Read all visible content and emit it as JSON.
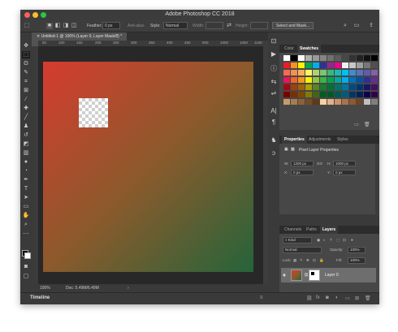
{
  "window": {
    "title": "Adobe Photoshop CC 2018"
  },
  "options_bar": {
    "feather_label": "Feather:",
    "feather_value": "0 px",
    "antialias_label": "Anti-alias",
    "style_label": "Style:",
    "style_value": "Normal",
    "width_label": "Width:",
    "height_label": "Height:",
    "select_mask_label": "Select and Mask..."
  },
  "document": {
    "tab_label": "Untitled-1 @ 100% (Layer 0, Layer Mask/8) *",
    "zoom": "100%",
    "doc_info": "Doc: 5.49M/6.49M"
  },
  "ruler": {
    "ticks": [
      "50",
      "100",
      "150",
      "200",
      "250",
      "300",
      "350",
      "400",
      "450",
      "500",
      "550",
      "600",
      "650",
      "700",
      "750",
      "800",
      "850",
      "900",
      "950",
      "1000",
      "1050",
      "1100"
    ]
  },
  "timeline": {
    "label": "Timeline"
  },
  "swatches_panel": {
    "tabs": [
      "Color",
      "Swatches"
    ],
    "active_tab": "Swatches",
    "colors": [
      [
        "#ffffff",
        "#000000",
        "#ffffff",
        "#b0b0b0",
        "#9a9a9a",
        "#858585",
        "#707070",
        "#5c5c5c",
        "#474747",
        "#333333",
        "#222222",
        "#111111",
        "#000000"
      ],
      [
        "#ed1c24",
        "#f7941d",
        "#fff200",
        "#00a651",
        "#00aeef",
        "#2e3192",
        "#92278f",
        "#ec008c",
        "#f0f0f0",
        "#c8c8c8",
        "#a0a0a0",
        "#787878",
        "#505050"
      ],
      [
        "#f26c4f",
        "#f68e55",
        "#fbaf5c",
        "#fff467",
        "#acd372",
        "#7cc576",
        "#3bb878",
        "#1abbb4",
        "#00bff3",
        "#438ccb",
        "#5574b9",
        "#605ca8",
        "#855fa8"
      ],
      [
        "#ed145b",
        "#f26522",
        "#f7941d",
        "#fff200",
        "#8dc63f",
        "#39b54a",
        "#00a651",
        "#00a99d",
        "#00aeef",
        "#0072bc",
        "#0054a6",
        "#2e3192",
        "#662d91"
      ],
      [
        "#9e0b0f",
        "#a0410d",
        "#a36209",
        "#aba000",
        "#598527",
        "#1a7b30",
        "#007236",
        "#00746b",
        "#0076a3",
        "#004b80",
        "#003471",
        "#1b1464",
        "#440e62"
      ],
      [
        "#790000",
        "#7b2e00",
        "#7d4900",
        "#827b00",
        "#406618",
        "#005e20",
        "#005826",
        "#005952",
        "#005b7f",
        "#003663",
        "#002157",
        "#0d004c",
        "#32004b"
      ],
      [
        "#c69c6d",
        "#a67c52",
        "#8c6239",
        "#754c24",
        "#603913",
        "#f5d0a9",
        "#e3b18a",
        "#c7926b",
        "#a6744f",
        "#8a5a35",
        "#6f4424",
        "#c0c0c0",
        "#808080"
      ]
    ]
  },
  "properties_panel": {
    "tabs": [
      "Properties",
      "Adjustments",
      "Styles"
    ],
    "active_tab": "Properties",
    "title": "Pixel Layer Properties",
    "w_label": "W:",
    "w_value": "1200 px",
    "go_label": "GO",
    "h_label": "H:",
    "h_value": "1000 px",
    "x_label": "X:",
    "x_value": "0 px",
    "y_label": "Y:",
    "y_value": "0 px"
  },
  "layers_panel": {
    "tabs": [
      "Channels",
      "Paths",
      "Layers"
    ],
    "active_tab": "Layers",
    "filter_value": "Kind",
    "blend_mode": "Normal",
    "opacity_label": "Opacity:",
    "opacity_value": "100%",
    "lock_label": "Lock:",
    "fill_label": "Fill:",
    "fill_value": "100%",
    "layer_name": "Layer 0"
  },
  "colors": {
    "gradient_start": "#d63b2f",
    "gradient_end": "#25643a",
    "ui_background": "#535353",
    "panel_background": "#474747"
  }
}
